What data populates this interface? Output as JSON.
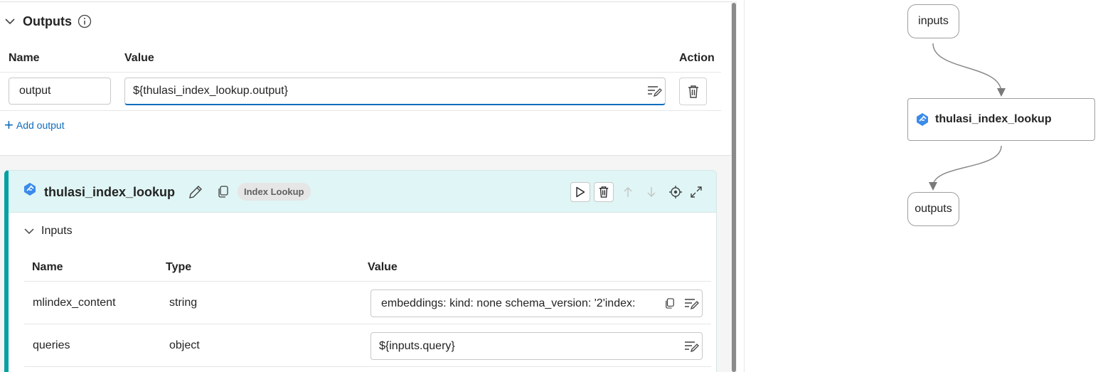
{
  "outputs_section": {
    "title": "Outputs",
    "columns": {
      "name": "Name",
      "value": "Value",
      "action": "Action"
    },
    "rows": [
      {
        "name": "output",
        "value": "${thulasi_index_lookup.output}"
      }
    ],
    "add_label": "Add output"
  },
  "node": {
    "title": "thulasi_index_lookup",
    "badge": "Index Lookup",
    "accent_color": "#05a1a3",
    "inputs": {
      "title": "Inputs",
      "columns": {
        "name": "Name",
        "type": "Type",
        "value": "Value"
      },
      "rows": [
        {
          "name": "mlindex_content",
          "type": "string",
          "value": "embeddings:  kind: none  schema_version: '2'index:"
        },
        {
          "name": "queries",
          "type": "object",
          "value": "${inputs.query}"
        }
      ]
    }
  },
  "graph": {
    "inputs_label": "inputs",
    "node_label": "thulasi_index_lookup",
    "outputs_label": "outputs"
  }
}
